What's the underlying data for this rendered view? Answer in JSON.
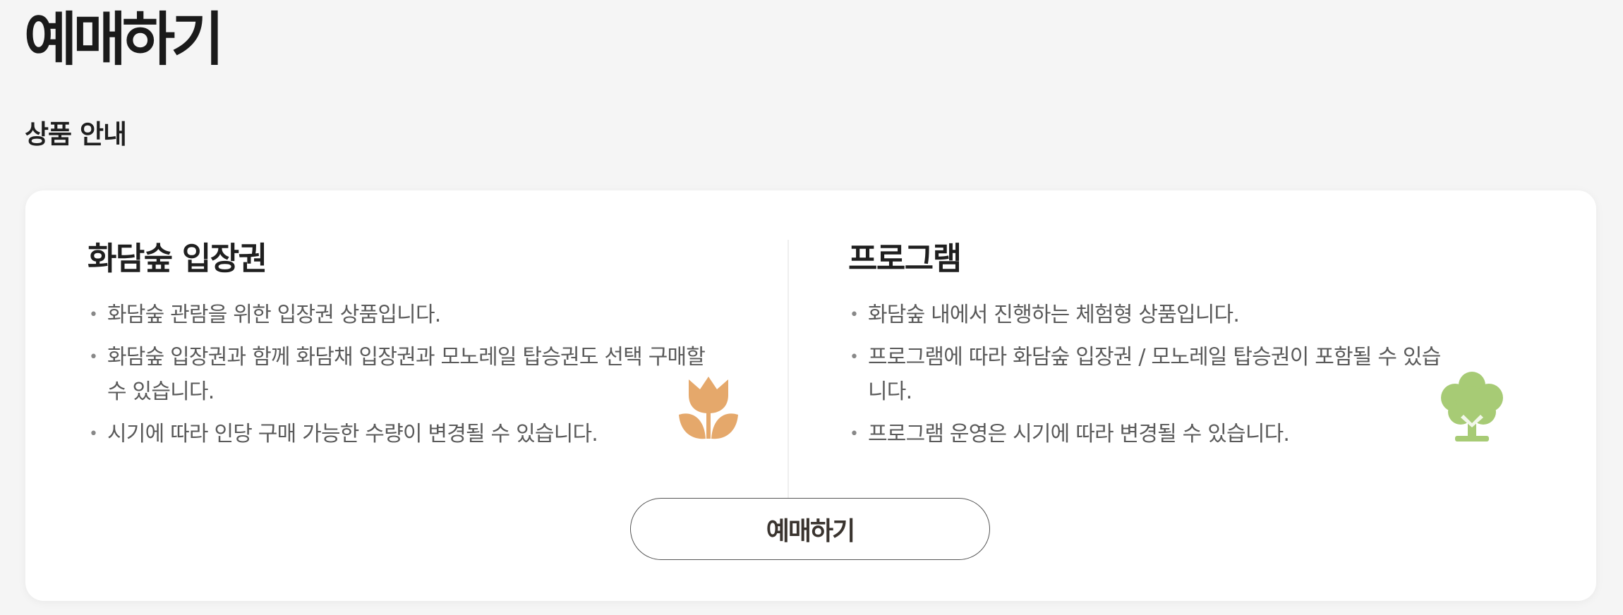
{
  "page": {
    "title": "예매하기",
    "section_title": "상품 안내"
  },
  "card": {
    "left": {
      "title": "화담숲 입장권",
      "items": [
        "화담숲 관람을 위한 입장권 상품입니다.",
        "화담숲 입장권과 함께 화담채 입장권과 모노레일 탑승권도 선택 구매할 수 있습니다.",
        "시기에 따라 인당 구매 가능한 수량이 변경될 수 있습니다."
      ],
      "icon": "tulip-icon",
      "icon_color": "#E5A86B"
    },
    "right": {
      "title": "프로그램",
      "items": [
        "화담숲 내에서 진행하는 체험형 상품입니다.",
        "프로그램에 따라 화담숲 입장권 / 모노레일 탑승권이 포함될 수 있습니다.",
        "프로그램 운영은 시기에 따라 변경될 수 있습니다."
      ],
      "icon": "tree-icon",
      "icon_color": "#A7CB75"
    },
    "button_label": "예매하기"
  }
}
